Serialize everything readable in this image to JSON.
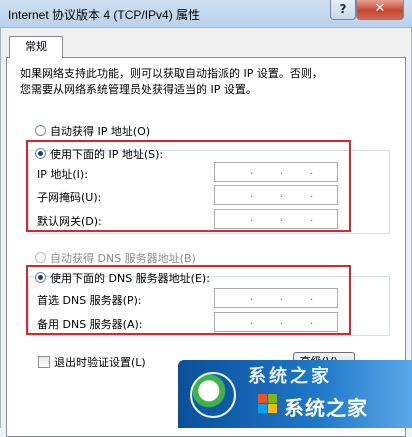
{
  "window": {
    "title": "Internet 协议版本 4 (TCP/IPv4) 属性",
    "help_label": "?",
    "close_label": "✕"
  },
  "tab": {
    "label": "常规"
  },
  "description": "如果网络支持此功能，则可以获取自动指派的 IP 设置。否则，\n您需要从网络系统管理员处获得适当的 IP 设置。",
  "ip_section": {
    "auto_label": "自动获得 IP 地址(O)",
    "manual_label": "使用下面的 IP 地址(S):",
    "selected": "manual",
    "fields": [
      {
        "label": "IP 地址(I):",
        "value": ""
      },
      {
        "label": "子网掩码(U):",
        "value": ""
      },
      {
        "label": "默认网关(D):",
        "value": ""
      }
    ]
  },
  "dns_section": {
    "auto_label": "自动获得 DNS 服务器地址(B)",
    "manual_label": "使用下面的 DNS 服务器地址(E):",
    "selected": "manual",
    "fields": [
      {
        "label": "首选 DNS 服务器(P):",
        "value": ""
      },
      {
        "label": "备用 DNS 服务器(A):",
        "value": ""
      }
    ]
  },
  "validate_checkbox": {
    "label": "退出时验证设置(L)",
    "checked": false
  },
  "advanced_button": {
    "label": "高级(V)..."
  },
  "watermark": {
    "text_top": "系统之家",
    "text_bottom": "系统之家"
  }
}
